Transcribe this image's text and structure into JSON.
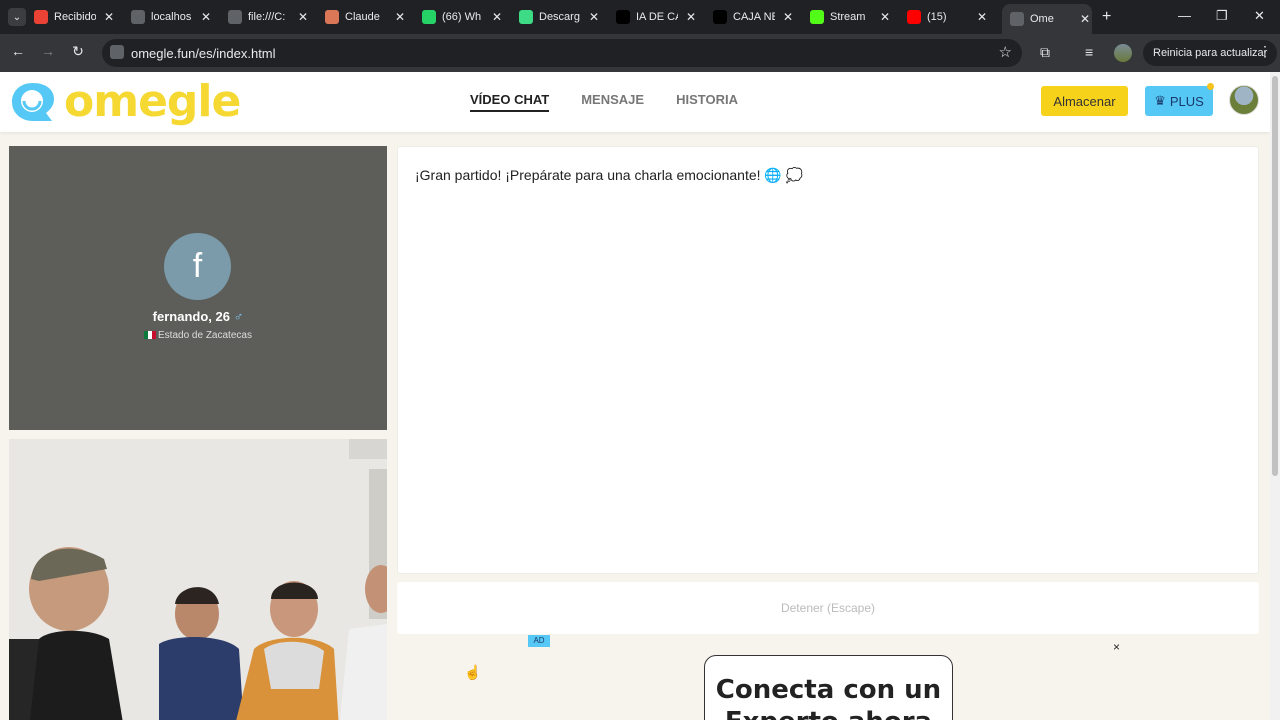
{
  "browser": {
    "tabs": [
      {
        "label": "Recibido",
        "favicon": "gmail-icon",
        "color": "#ea4335"
      },
      {
        "label": "localhos",
        "favicon": "page-icon",
        "color": "#5f6368"
      },
      {
        "label": "file:///C:",
        "favicon": "globe-icon",
        "color": "#5f6368"
      },
      {
        "label": "Claude",
        "favicon": "claude-icon",
        "color": "#d97757"
      },
      {
        "label": "(66) Wh",
        "favicon": "whatsapp-icon",
        "color": "#25d366"
      },
      {
        "label": "Descarg",
        "favicon": "d-icon",
        "color": "#3ddc84"
      },
      {
        "label": "IA DE CA",
        "favicon": "openai-icon",
        "color": "#000000"
      },
      {
        "label": "CAJA NE",
        "favicon": "openai-icon",
        "color": "#000000"
      },
      {
        "label": "Stream",
        "favicon": "kick-icon",
        "color": "#53fc18"
      },
      {
        "label": "(15)",
        "favicon": "youtube-icon",
        "color": "#ff0000"
      },
      {
        "label": "Ome",
        "favicon": "omegle-icon",
        "color": "#5f6368",
        "active": true
      }
    ],
    "url": "omegle.fun/es/index.html",
    "update_label": "Reinicia para actualizar"
  },
  "header": {
    "logo_text": "omegle",
    "nav": [
      {
        "label": "VÍDEO CHAT",
        "active": true
      },
      {
        "label": "MENSAJE",
        "active": false
      },
      {
        "label": "HISTORIA",
        "active": false
      }
    ],
    "store_label": "Almacenar",
    "plus_label": "PLUS"
  },
  "stranger": {
    "initial": "f",
    "name": "fernando, 26",
    "gender_symbol": "♂",
    "location": "Estado de Zacatecas"
  },
  "chat": {
    "message": "¡Gran partido! ¡Prepárate para una charla emocionante! 🌐 💭"
  },
  "controls": {
    "stop_label": "Detener (Escape)"
  },
  "ad": {
    "badge": "AD",
    "close": "×",
    "title": "Conecta con un Experto ahora"
  },
  "colors": {
    "brand_yellow": "#f6d832",
    "brand_blue": "#56c8f5",
    "store_yellow": "#f6d21b"
  }
}
